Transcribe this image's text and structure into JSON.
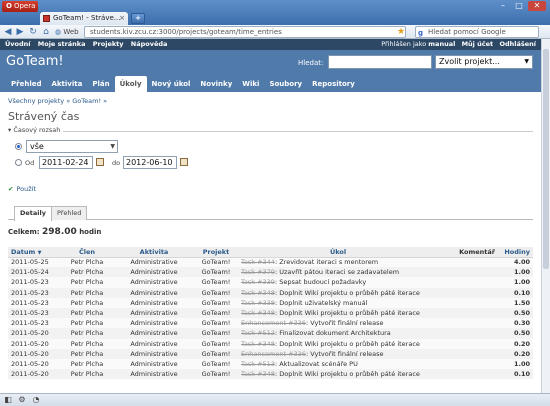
{
  "browser": {
    "menu_label": "Opera",
    "tab_title": "GoTeam! - Stráve...",
    "address_prefix": "Web",
    "url": "students.kiv.zcu.cz:3000/projects/goteam/time_entries",
    "search_placeholder": "Hledat pomocí Google"
  },
  "topmenu": {
    "left": [
      "Úvodní",
      "Moje stránka",
      "Projekty",
      "Nápověda"
    ],
    "logged_in_as": "Přihlášen jako",
    "user": "manual",
    "account": "Můj účet",
    "logout": "Odhlášení"
  },
  "header": {
    "title": "GoTeam!",
    "search_label": "Hledat:",
    "project_select": "Zvolit projekt..."
  },
  "mainmenu": [
    "Přehled",
    "Aktivita",
    "Plán",
    "Úkoly",
    "Nový úkol",
    "Novinky",
    "Wiki",
    "Soubory",
    "Repository"
  ],
  "breadcrumb": "Všechny projekty » GoTeam! »",
  "page_title": "Strávený čas",
  "filter": {
    "legend": "Časový rozsah",
    "period_value": "vše",
    "from_label": "Od",
    "from_value": "2011-02-24",
    "to_label": "do",
    "to_value": "2012-06-10",
    "apply_label": "Použít"
  },
  "tabs": [
    "Detaily",
    "Přehled"
  ],
  "total": {
    "label": "Celkem:",
    "value": "298.00",
    "unit": "hodin"
  },
  "table": {
    "headers": [
      "Datum",
      "Člen",
      "Aktivita",
      "Projekt",
      "Úkol",
      "Komentář",
      "Hodiny"
    ],
    "rows": [
      {
        "date": "2011-05-25",
        "user": "Petr Plcha",
        "activity": "Administrative",
        "project": "GoTeam!",
        "task_ref": "Task #344",
        "task_title": ": Zrevidovat iteraci s mentorem",
        "hours": "4.00"
      },
      {
        "date": "2011-05-24",
        "user": "Petr Plcha",
        "activity": "Administrative",
        "project": "GoTeam!",
        "task_ref": "Task #379",
        "task_title": ": Uzavřít pátou iteraci se zadavatelem",
        "hours": "1.00"
      },
      {
        "date": "2011-05-23",
        "user": "Petr Plcha",
        "activity": "Administrative",
        "project": "GoTeam!",
        "task_ref": "Task #339",
        "task_title": ": Sepsat budoucí požadavky",
        "hours": "1.00"
      },
      {
        "date": "2011-05-23",
        "user": "Petr Plcha",
        "activity": "Administrative",
        "project": "GoTeam!",
        "task_ref": "Task #348",
        "task_title": ": Doplnit Wiki projektu o průběh páté iterace",
        "hours": "0.10"
      },
      {
        "date": "2011-05-23",
        "user": "Petr Plcha",
        "activity": "Administrative",
        "project": "GoTeam!",
        "task_ref": "Task #338",
        "task_title": ": Doplnit uživatelský manuál",
        "hours": "1.50"
      },
      {
        "date": "2011-05-23",
        "user": "Petr Plcha",
        "activity": "Administrative",
        "project": "GoTeam!",
        "task_ref": "Task #348",
        "task_title": ": Doplnit Wiki projektu o průběh páté iterace",
        "hours": "0.50"
      },
      {
        "date": "2011-05-23",
        "user": "Petr Plcha",
        "activity": "Administrative",
        "project": "GoTeam!",
        "task_ref": "Enhancement #336",
        "task_title": ": Vytvořit finální release",
        "hours": "0.30"
      },
      {
        "date": "2011-05-20",
        "user": "Petr Plcha",
        "activity": "Administrative",
        "project": "GoTeam!",
        "task_ref": "Task #512",
        "task_title": ": Finalizovat dokument Architektura",
        "hours": "0.50"
      },
      {
        "date": "2011-05-20",
        "user": "Petr Plcha",
        "activity": "Administrative",
        "project": "GoTeam!",
        "task_ref": "Task #348",
        "task_title": ": Doplnit Wiki projektu o průběh páté iterace",
        "hours": "0.20"
      },
      {
        "date": "2011-05-20",
        "user": "Petr Plcha",
        "activity": "Administrative",
        "project": "GoTeam!",
        "task_ref": "Enhancement #336",
        "task_title": ": Vytvořit finální release",
        "hours": "0.20"
      },
      {
        "date": "2011-05-20",
        "user": "Petr Plcha",
        "activity": "Administrative",
        "project": "GoTeam!",
        "task_ref": "Task #513",
        "task_title": ": Aktualizovat scénáře PU",
        "hours": "1.00"
      },
      {
        "date": "2011-05-20",
        "user": "Petr Plcha",
        "activity": "Administrative",
        "project": "GoTeam!",
        "task_ref": "Task #348",
        "task_title": ": Doplnit Wiki projektu o průběh páté iterace",
        "hours": "0.10"
      }
    ]
  },
  "colors": {
    "brand_dark": "#2c4865",
    "brand": "#507aaa",
    "link": "#2a5a8a"
  }
}
